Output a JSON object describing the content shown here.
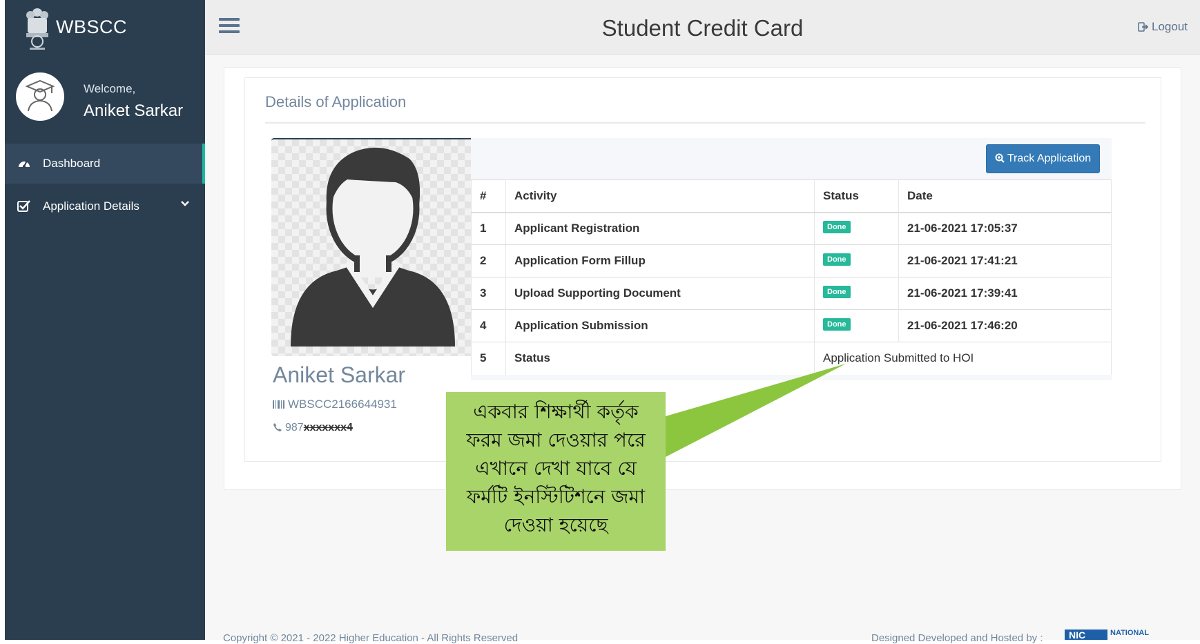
{
  "sidebar": {
    "brand": "WBSCC",
    "welcome": "Welcome,",
    "user_name": "Aniket Sarkar",
    "nav": [
      {
        "label": "Dashboard",
        "icon": "tachometer-icon"
      },
      {
        "label": "Application Details",
        "icon": "checkbox-icon"
      }
    ]
  },
  "header": {
    "title": "Student Credit Card",
    "logout": "Logout"
  },
  "panel": {
    "title": "Details of Application",
    "student_name": "Aniket Sarkar",
    "student_id": "WBSCC2166644931",
    "phone_prefix": "987",
    "phone_masked": "xxxxxxx4",
    "track_button": "Track Application"
  },
  "table": {
    "headers": [
      "#",
      "Activity",
      "Status",
      "Date"
    ],
    "rows": [
      {
        "num": "1",
        "activity": "Applicant Registration",
        "status": "Done",
        "date": "21-06-2021 17:05:37"
      },
      {
        "num": "2",
        "activity": "Application Form Fillup",
        "status": "Done",
        "date": "21-06-2021 17:41:21"
      },
      {
        "num": "3",
        "activity": "Upload Supporting Document",
        "status": "Done",
        "date": "21-06-2021 17:39:41"
      },
      {
        "num": "4",
        "activity": "Application Submission",
        "status": "Done",
        "date": "21-06-2021 17:46:20"
      },
      {
        "num": "5",
        "activity": "Status",
        "status_text": "Application Submitted to HOI"
      }
    ]
  },
  "annotation": {
    "lines": [
      "একবার শিক্ষার্থী কর্তৃক",
      "ফরম জমা দেওয়ার পরে",
      "এখানে দেখা যাবে যে",
      "ফর্মটি ইনস্টিটিশনে জমা",
      "দেওয়া হয়েছে"
    ],
    "color": "#a9d46a"
  },
  "footer": {
    "copyright": "Copyright © 2021 - 2022 Higher Education - All Rights Reserved",
    "credit": "Designed Developed and Hosted by :",
    "nic_label": "NATIONAL"
  },
  "colors": {
    "sidebar": "#2b3e50",
    "accent": "#1abb9c",
    "done_badge": "#26b99a",
    "button": "#337ab7"
  }
}
